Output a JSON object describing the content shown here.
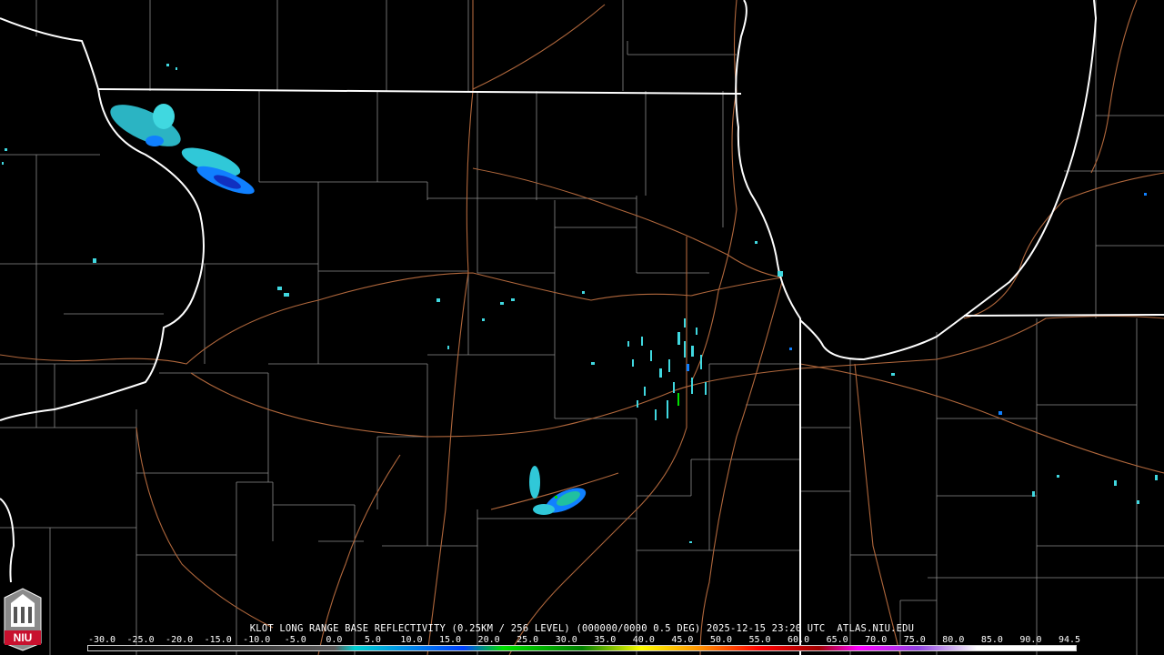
{
  "caption": "KLOT LONG RANGE BASE REFLECTIVITY (0.25KM / 256 LEVEL) (000000/0000 0.5 DEG) 2025-12-15 23:20 UTC  ATLAS.NIU.EDU",
  "logo_text": "NIU",
  "scale": {
    "ticks": [
      "-30.0",
      "-25.0",
      "-20.0",
      "-15.0",
      "-10.0",
      "-5.0",
      "0.0",
      "5.0",
      "10.0",
      "15.0",
      "20.0",
      "25.0",
      "30.0",
      "35.0",
      "40.0",
      "45.0",
      "50.0",
      "55.0",
      "60.0",
      "65.0",
      "70.0",
      "75.0",
      "80.0",
      "85.0",
      "90.0",
      "94.5"
    ],
    "colors": {
      "low": "#5a5a5a",
      "cyan": "#00d0d0",
      "blue": "#0040ff",
      "green": "#00e000",
      "yellow": "#ffff00",
      "orange": "#ff9000",
      "red": "#ff0000",
      "magenta": "#ff00ff",
      "purple": "#9040e0",
      "white": "#ffffff"
    }
  },
  "map_colors": {
    "state_border": "#ffffff",
    "county_line": "#8a8a8a",
    "road": "#b0673c",
    "echo_light": "#40d8e0",
    "echo_mid": "#1080ff",
    "echo_strong": "#1030c0"
  }
}
